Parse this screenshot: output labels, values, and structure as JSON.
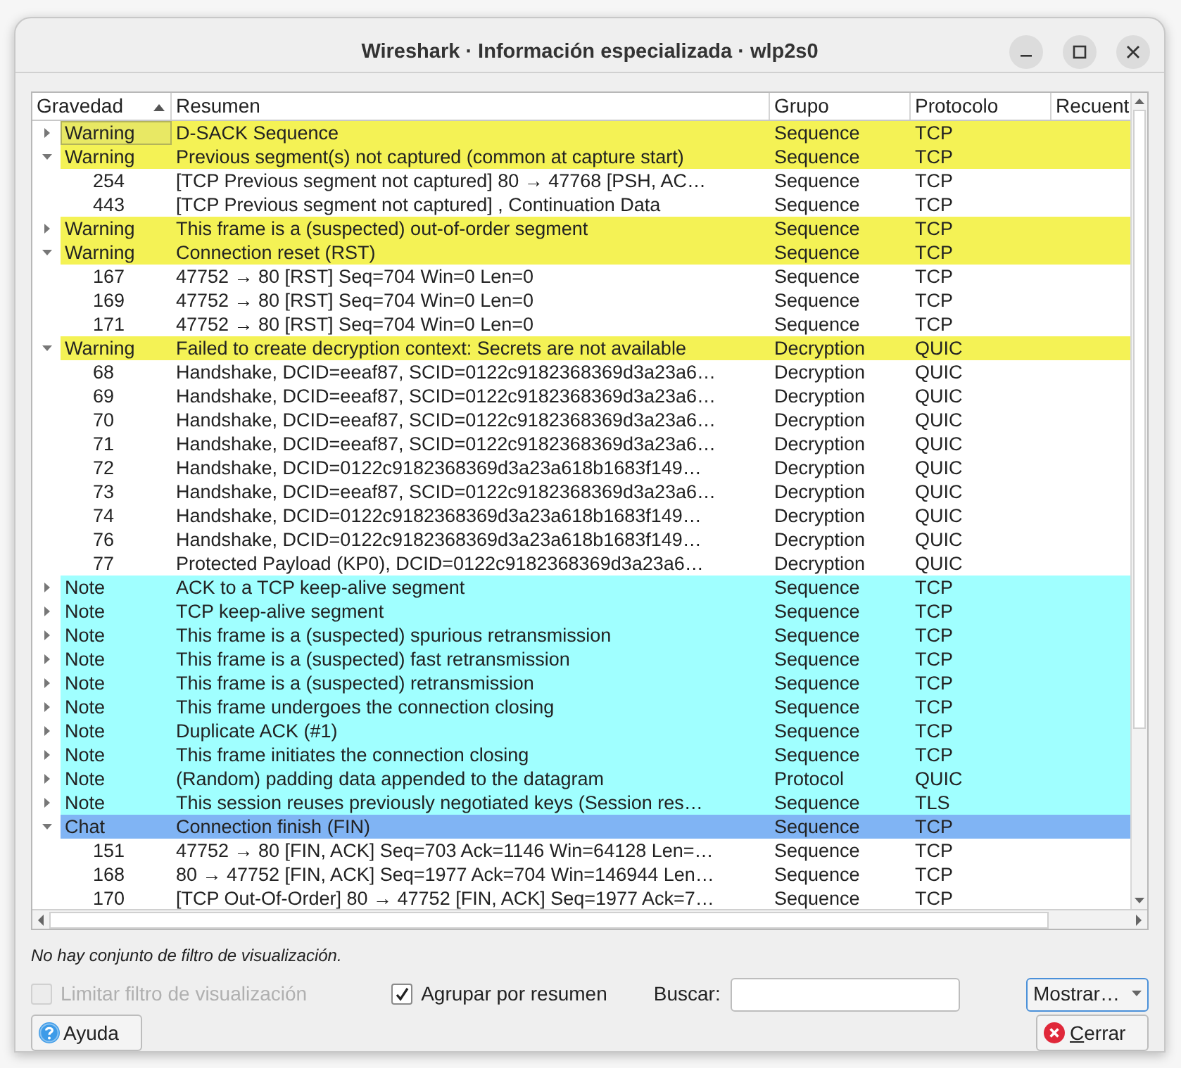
{
  "window": {
    "title": "Wireshark · Información especializada · wlp2s0"
  },
  "table": {
    "columns": [
      {
        "label": "Gravedad",
        "sorted": true
      },
      {
        "label": "Resumen",
        "sorted": false
      },
      {
        "label": "Grupo",
        "sorted": false
      },
      {
        "label": "Protocolo",
        "sorted": false
      },
      {
        "label": "Recuent",
        "sorted": false
      }
    ],
    "groups": [
      {
        "kind": "warning",
        "severity": "Warning",
        "summary": "D-SACK Sequence",
        "group": "Sequence",
        "protocol": "TCP",
        "expanded": false,
        "selected": true
      },
      {
        "kind": "warning",
        "severity": "Warning",
        "summary": "Previous segment(s) not captured (common at capture start)",
        "group": "Sequence",
        "protocol": "TCP",
        "expanded": true,
        "selected": false,
        "children": [
          {
            "number": "254",
            "summary": "[TCP Previous segment not captured] 80 → 47768 [PSH, AC…",
            "group": "Sequence",
            "protocol": "TCP"
          },
          {
            "number": "443",
            "summary": "[TCP Previous segment not captured] , Continuation Data",
            "group": "Sequence",
            "protocol": "TCP"
          }
        ]
      },
      {
        "kind": "warning",
        "severity": "Warning",
        "summary": "This frame is a (suspected) out-of-order segment",
        "group": "Sequence",
        "protocol": "TCP",
        "expanded": false,
        "selected": false
      },
      {
        "kind": "warning",
        "severity": "Warning",
        "summary": "Connection reset (RST)",
        "group": "Sequence",
        "protocol": "TCP",
        "expanded": true,
        "selected": false,
        "children": [
          {
            "number": "167",
            "summary": "47752 → 80 [RST] Seq=704 Win=0 Len=0",
            "group": "Sequence",
            "protocol": "TCP"
          },
          {
            "number": "169",
            "summary": "47752 → 80 [RST] Seq=704 Win=0 Len=0",
            "group": "Sequence",
            "protocol": "TCP"
          },
          {
            "number": "171",
            "summary": "47752 → 80 [RST] Seq=704 Win=0 Len=0",
            "group": "Sequence",
            "protocol": "TCP"
          }
        ]
      },
      {
        "kind": "warning",
        "severity": "Warning",
        "summary": "Failed to create decryption context: Secrets are not available",
        "group": "Decryption",
        "protocol": "QUIC",
        "expanded": true,
        "selected": false,
        "children": [
          {
            "number": "68",
            "summary": "Handshake, DCID=eeaf87, SCID=0122c9182368369d3a23a6…",
            "group": "Decryption",
            "protocol": "QUIC"
          },
          {
            "number": "69",
            "summary": "Handshake, DCID=eeaf87, SCID=0122c9182368369d3a23a6…",
            "group": "Decryption",
            "protocol": "QUIC"
          },
          {
            "number": "70",
            "summary": "Handshake, DCID=eeaf87, SCID=0122c9182368369d3a23a6…",
            "group": "Decryption",
            "protocol": "QUIC"
          },
          {
            "number": "71",
            "summary": "Handshake, DCID=eeaf87, SCID=0122c9182368369d3a23a6…",
            "group": "Decryption",
            "protocol": "QUIC"
          },
          {
            "number": "72",
            "summary": "Handshake, DCID=0122c9182368369d3a23a618b1683f149…",
            "group": "Decryption",
            "protocol": "QUIC"
          },
          {
            "number": "73",
            "summary": "Handshake, DCID=eeaf87, SCID=0122c9182368369d3a23a6…",
            "group": "Decryption",
            "protocol": "QUIC"
          },
          {
            "number": "74",
            "summary": "Handshake, DCID=0122c9182368369d3a23a618b1683f149…",
            "group": "Decryption",
            "protocol": "QUIC"
          },
          {
            "number": "76",
            "summary": "Handshake, DCID=0122c9182368369d3a23a618b1683f149…",
            "group": "Decryption",
            "protocol": "QUIC"
          },
          {
            "number": "77",
            "summary": "Protected Payload (KP0), DCID=0122c9182368369d3a23a6…",
            "group": "Decryption",
            "protocol": "QUIC"
          }
        ]
      },
      {
        "kind": "note",
        "severity": "Note",
        "summary": "ACK to a TCP keep-alive segment",
        "group": "Sequence",
        "protocol": "TCP",
        "expanded": false,
        "selected": false
      },
      {
        "kind": "note",
        "severity": "Note",
        "summary": "TCP keep-alive segment",
        "group": "Sequence",
        "protocol": "TCP",
        "expanded": false,
        "selected": false
      },
      {
        "kind": "note",
        "severity": "Note",
        "summary": "This frame is a (suspected) spurious retransmission",
        "group": "Sequence",
        "protocol": "TCP",
        "expanded": false,
        "selected": false
      },
      {
        "kind": "note",
        "severity": "Note",
        "summary": "This frame is a (suspected) fast retransmission",
        "group": "Sequence",
        "protocol": "TCP",
        "expanded": false,
        "selected": false
      },
      {
        "kind": "note",
        "severity": "Note",
        "summary": "This frame is a (suspected) retransmission",
        "group": "Sequence",
        "protocol": "TCP",
        "expanded": false,
        "selected": false
      },
      {
        "kind": "note",
        "severity": "Note",
        "summary": "This frame undergoes the connection closing",
        "group": "Sequence",
        "protocol": "TCP",
        "expanded": false,
        "selected": false
      },
      {
        "kind": "note",
        "severity": "Note",
        "summary": "Duplicate ACK (#1)",
        "group": "Sequence",
        "protocol": "TCP",
        "expanded": false,
        "selected": false
      },
      {
        "kind": "note",
        "severity": "Note",
        "summary": "This frame initiates the connection closing",
        "group": "Sequence",
        "protocol": "TCP",
        "expanded": false,
        "selected": false
      },
      {
        "kind": "note",
        "severity": "Note",
        "summary": "(Random) padding data appended to the datagram",
        "group": "Protocol",
        "protocol": "QUIC",
        "expanded": false,
        "selected": false
      },
      {
        "kind": "note",
        "severity": "Note",
        "summary": "This session reuses previously negotiated keys (Session res…",
        "group": "Sequence",
        "protocol": "TLS",
        "expanded": false,
        "selected": false
      },
      {
        "kind": "chat",
        "severity": "Chat",
        "summary": "Connection finish (FIN)",
        "group": "Sequence",
        "protocol": "TCP",
        "expanded": true,
        "selected": false,
        "children": [
          {
            "number": "151",
            "summary": "47752 → 80 [FIN, ACK] Seq=703 Ack=1146 Win=64128 Len=…",
            "group": "Sequence",
            "protocol": "TCP"
          },
          {
            "number": "168",
            "summary": "80 → 47752 [FIN, ACK] Seq=1977 Ack=704 Win=146944 Len…",
            "group": "Sequence",
            "protocol": "TCP"
          },
          {
            "number": "170",
            "summary": "[TCP Out-Of-Order] 80 → 47752 [FIN, ACK] Seq=1977 Ack=7…",
            "group": "Sequence",
            "protocol": "TCP"
          }
        ]
      }
    ]
  },
  "filter_status": "No hay conjunto de filtro de visualización.",
  "options": [
    {
      "kind": "checkbox",
      "label": "Limitar filtro de visualización",
      "checked": false,
      "disabled": true
    },
    {
      "kind": "checkbox",
      "label": "Agrupar por resumen",
      "checked": true,
      "disabled": false
    }
  ],
  "search": {
    "label": "Buscar:"
  },
  "buttons": [
    {
      "kind": "menu",
      "label": "Mostrar…"
    },
    {
      "kind": "help",
      "label": "Ayuda"
    },
    {
      "kind": "close",
      "label": "Cerrar"
    }
  ]
}
